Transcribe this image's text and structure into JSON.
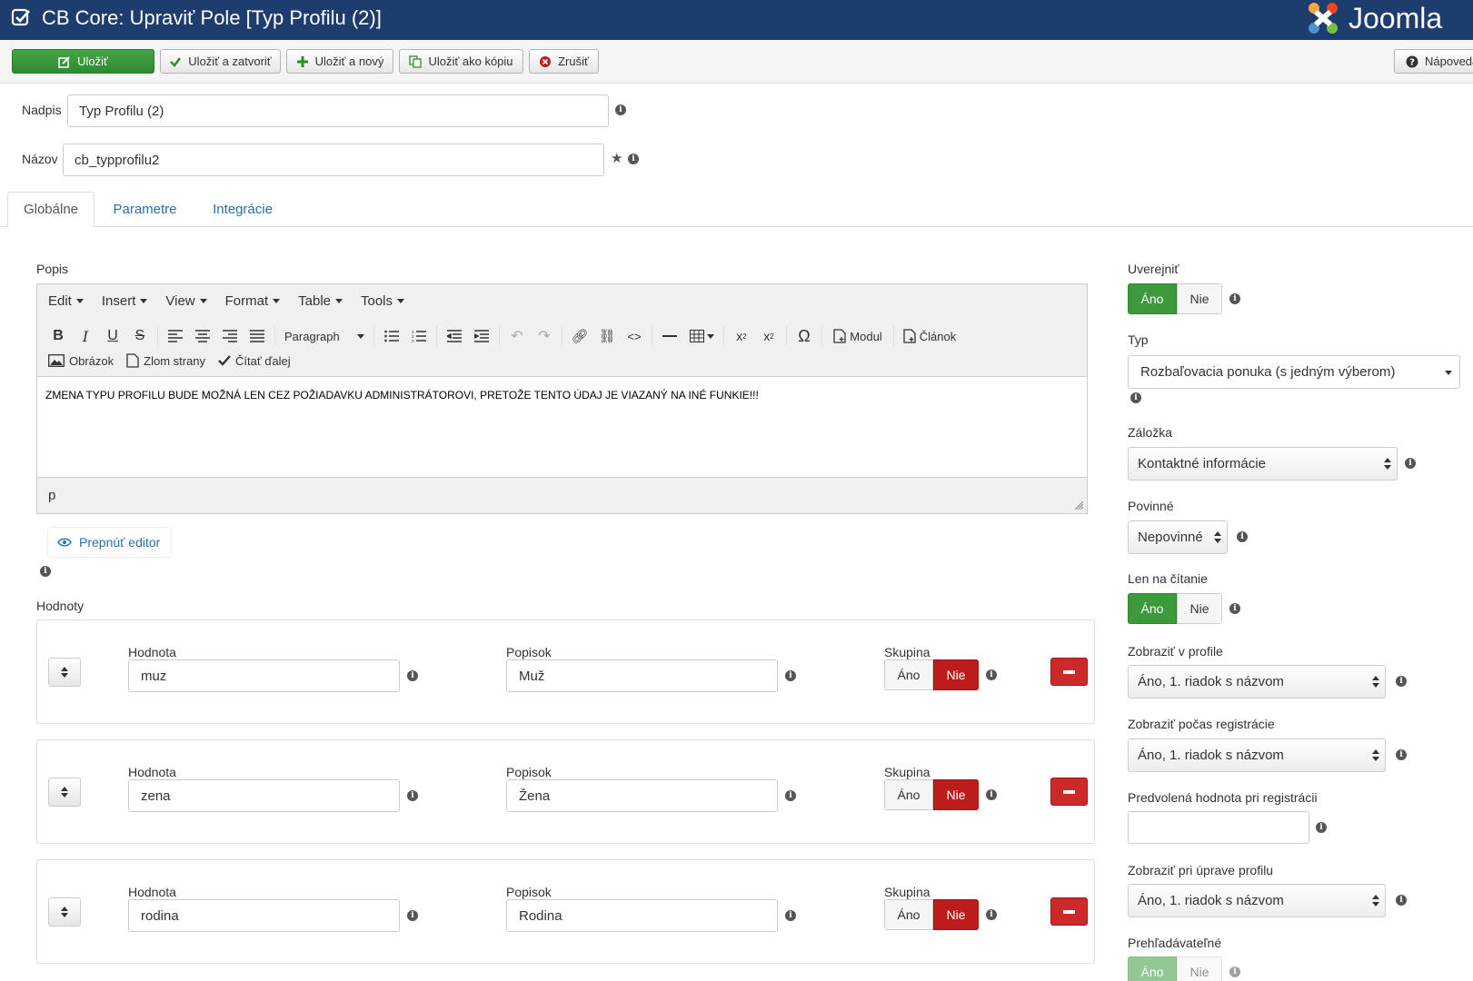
{
  "header": {
    "title": "CB Core: Upraviť Pole [Typ Profilu (2)]",
    "logo_text": "Joomla"
  },
  "toolbar": {
    "save": "Uložiť",
    "save_close": "Uložiť a zatvoriť",
    "save_new": "Uložiť a nový",
    "save_copy": "Uložiť ako kópiu",
    "cancel": "Zrušiť",
    "help": "Nápoveda"
  },
  "fields": {
    "title_label": "Nadpis",
    "title_value": "Typ Profilu (2)",
    "name_label": "Názov",
    "name_value": "cb_typprofilu2"
  },
  "tabs": [
    "Globálne",
    "Parametre",
    "Integrácie"
  ],
  "editor": {
    "label": "Popis",
    "menus": [
      "Edit",
      "Insert",
      "View",
      "Format",
      "Table",
      "Tools"
    ],
    "paragraph": "Paragraph",
    "modul": "Modul",
    "clanok": "Článok",
    "obrazok": "Obrázok",
    "zlom": "Zlom strany",
    "citat": "Čítať ďalej",
    "content": "ZMENA TYPU PROFILU BUDE MOŽNÁ LEN CEZ POŽIADAVKU ADMINISTRÁTOROVI, PRETOŽE TENTO ÚDAJ JE VIAZANÝ NA INÉ FUNKIE!!!",
    "status": "p",
    "switch": "Prepnúť editor"
  },
  "values": {
    "label": "Hodnoty",
    "col_value": "Hodnota",
    "col_label": "Popisok",
    "col_group": "Skupina",
    "yes": "Áno",
    "no": "Nie",
    "rows": [
      {
        "value": "muz",
        "label": "Muž"
      },
      {
        "value": "zena",
        "label": "Žena"
      },
      {
        "value": "rodina",
        "label": "Rodina"
      }
    ]
  },
  "right": {
    "publish_label": "Uverejniť",
    "yes": "Áno",
    "no": "Nie",
    "type_label": "Typ",
    "type_value": "Rozbaľovacia ponuka (s jedným výberom)",
    "tab_label": "Záložka",
    "tab_value": "Kontaktné informácie",
    "required_label": "Povinné",
    "required_value": "Nepovinné",
    "readonly_label": "Len na čítanie",
    "profile_label": "Zobraziť v profile",
    "profile_value": "Áno, 1. riadok s názvom",
    "reg_label": "Zobraziť počas registrácie",
    "reg_value": "Áno, 1. riadok s názvom",
    "default_label": "Predvolená hodnota pri registrácii",
    "default_value": "",
    "edit_label": "Zobraziť pri úprave profilu",
    "edit_value": "Áno, 1. riadok s názvom",
    "search_label": "Prehľadávateľné"
  },
  "colors": {
    "header": "#1c3d6e",
    "green": "#3c9a3c",
    "red": "#bd1c1c",
    "link": "#2a6fb0"
  }
}
